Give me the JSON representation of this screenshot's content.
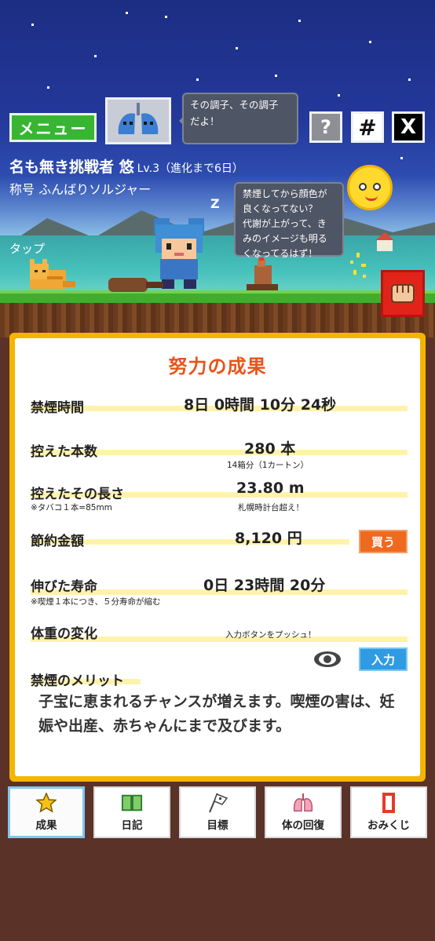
{
  "header": {
    "menu_label": "メニュー",
    "speech_top": [
      "その調子、その調子",
      "だよ！"
    ],
    "help_label": "?",
    "grid_label": "#",
    "x_label": "X"
  },
  "player": {
    "name": "名も無き挑戦者 悠",
    "level": "Lv.3（進化まで6日）",
    "title": "称号 ふんばりソルジャー"
  },
  "scene": {
    "speech_mid": [
      "禁煙してから顔色が",
      "良くなってない？",
      "代謝が上がって、き",
      "みのイメージも明る",
      "くなってるはず！"
    ],
    "tap_label": "タップ"
  },
  "results": {
    "title": "努力の成果",
    "rows": [
      {
        "label": "禁煙時間",
        "value": "8日  0時間  10分  24秒",
        "note": ""
      },
      {
        "label": "控えた本数",
        "value": "280  本",
        "note": "14箱分（1カートン）"
      },
      {
        "label": "控えたその長さ",
        "value": "23.80  m",
        "note": "札幌時計台超え！",
        "sub": "※タバコ１本=85mm"
      },
      {
        "label": "節約金額",
        "value": "8,120  円",
        "button": "買う"
      },
      {
        "label": "伸びた寿命",
        "value": "0日  23時間  20分",
        "sub": "※喫煙１本につき、５分寿命が縮む"
      },
      {
        "label": "体重の変化",
        "note": "入力ボタンをプッシュ！",
        "button": "入力"
      }
    ],
    "merit_label": "禁煙のメリット",
    "merit_text": "子宝に恵まれるチャンスが増えます。喫煙の害は、妊娠や出産、赤ちゃんにまで及びます。"
  },
  "tabs": [
    {
      "label": "成果",
      "icon": "star-icon"
    },
    {
      "label": "日記",
      "icon": "book-icon"
    },
    {
      "label": "目標",
      "icon": "flag-icon"
    },
    {
      "label": "体の回復",
      "icon": "lungs-icon"
    },
    {
      "label": "おみくじ",
      "icon": "omikuji-icon"
    }
  ],
  "colors": {
    "accent_orange": "#e85418",
    "panel_border": "#f5b400",
    "menu_green": "#39b534",
    "input_blue": "#2f9be2"
  }
}
